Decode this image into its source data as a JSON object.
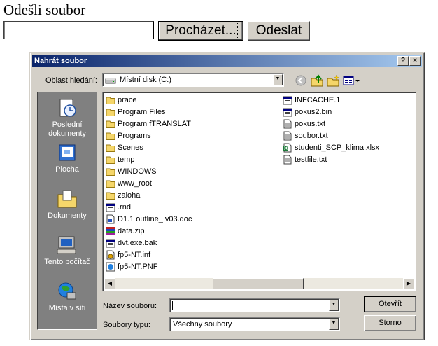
{
  "page": {
    "heading": "Odešli soubor",
    "browse_label": "Procházet...",
    "send_label": "Odeslat",
    "file_value": ""
  },
  "dialog": {
    "title": "Nahrát soubor",
    "help_btn": "?",
    "close_btn": "×",
    "look_in_label": "Oblast hledání:",
    "look_in_value": "Místní disk (C:)",
    "places": [
      {
        "label": "Poslední dokumenty",
        "icon": "recent-documents-icon"
      },
      {
        "label": "Plocha",
        "icon": "desktop-icon"
      },
      {
        "label": "Dokumenty",
        "icon": "my-documents-icon"
      },
      {
        "label": "Tento počítač",
        "icon": "my-computer-icon"
      },
      {
        "label": "Místa v síti",
        "icon": "network-places-icon"
      }
    ],
    "files_col1": [
      {
        "name": "prace",
        "type": "folder"
      },
      {
        "name": "Program Files",
        "type": "folder"
      },
      {
        "name": "Program fTRANSLAT",
        "type": "folder"
      },
      {
        "name": "Programs",
        "type": "folder"
      },
      {
        "name": "Scenes",
        "type": "folder"
      },
      {
        "name": "temp",
        "type": "folder"
      },
      {
        "name": "WINDOWS",
        "type": "folder"
      },
      {
        "name": "www_root",
        "type": "folder"
      },
      {
        "name": "zaloha",
        "type": "folder"
      },
      {
        "name": ".rnd",
        "type": "bin"
      },
      {
        "name": "D1.1 outline_ v03.doc",
        "type": "doc"
      },
      {
        "name": "data.zip",
        "type": "zip"
      },
      {
        "name": "dvt.exe.bak",
        "type": "bin"
      },
      {
        "name": "fp5-NT.inf",
        "type": "inf"
      },
      {
        "name": "fp5-NT.PNF",
        "type": "pnf"
      }
    ],
    "files_col2": [
      {
        "name": "INFCACHE.1",
        "type": "bin"
      },
      {
        "name": "pokus2.bin",
        "type": "bin"
      },
      {
        "name": "pokus.txt",
        "type": "txt"
      },
      {
        "name": "soubor.txt",
        "type": "txt"
      },
      {
        "name": "studenti_SCP_klima.xlsx",
        "type": "xlsx"
      },
      {
        "name": "testfile.txt",
        "type": "txt"
      }
    ],
    "filename_label": "Název souboru:",
    "filename_value": "",
    "filetype_label": "Soubory typu:",
    "filetype_value": "Všechny soubory",
    "open_label": "Otevřít",
    "cancel_label": "Storno"
  },
  "colors": {
    "titlebar_start": "#0a246a",
    "titlebar_end": "#a6caf0",
    "dialog_face": "#d4d0c8",
    "places_bar": "#808080",
    "folder_yellow": "#f5d66a"
  }
}
